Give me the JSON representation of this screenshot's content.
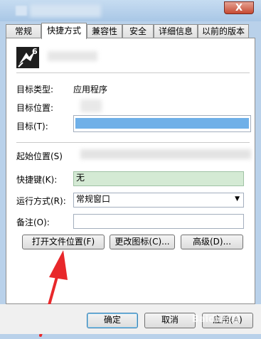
{
  "window": {
    "close_glyph": "X"
  },
  "tabs": [
    {
      "label": "常规"
    },
    {
      "label": "快捷方式"
    },
    {
      "label": "兼容性"
    },
    {
      "label": "安全"
    },
    {
      "label": "详细信息"
    },
    {
      "label": "以前的版本"
    }
  ],
  "shortcut": {
    "icon_number": "6",
    "target_type_label": "目标类型:",
    "target_type_value": "应用程序",
    "target_location_label": "目标位置:",
    "target_label": "目标(T):",
    "start_in_label": "起始位置(S)",
    "hotkey_label": "快捷键(K):",
    "hotkey_value": "无",
    "run_label": "运行方式(R):",
    "run_value": "常规窗口",
    "comment_label": "备注(O):",
    "comment_value": ""
  },
  "buttons": {
    "open_location": "打开文件位置(F)",
    "change_icon": "更改图标(C)...",
    "advanced": "高级(D)..."
  },
  "dialog": {
    "ok": "确定",
    "cancel": "取消",
    "apply": "应用(A)"
  },
  "watermark": "Baidu经验",
  "colors": {
    "hotkey_bg": "#d4ead4",
    "target_highlight": "#6fb0e8",
    "arrow": "#e8282b"
  }
}
